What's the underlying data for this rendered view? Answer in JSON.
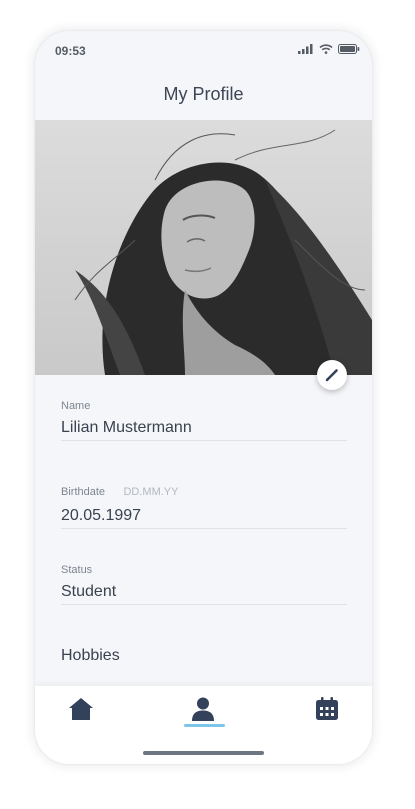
{
  "status_bar": {
    "time": "09:53",
    "icons": [
      "signal-icon",
      "wifi-icon",
      "battery-icon"
    ]
  },
  "header": {
    "title": "My Profile"
  },
  "profile": {
    "photo": "profile-photo-woman-bw",
    "edit_icon": "pencil-icon"
  },
  "fields": {
    "name": {
      "label": "Name",
      "value": "Lilian Mustermann"
    },
    "birthdate": {
      "label": "Birthdate",
      "hint": "DD.MM.YY",
      "value": "20.05.1997"
    },
    "status": {
      "label": "Status",
      "value": "Student"
    }
  },
  "hobbies": {
    "label": "Hobbies"
  },
  "tab_bar": {
    "tabs": [
      {
        "icon": "home-icon",
        "active": false
      },
      {
        "icon": "user-icon",
        "active": true
      },
      {
        "icon": "calendar-icon",
        "active": false
      }
    ],
    "accent_color": "#7dc6ea",
    "icon_color": "#33415a"
  }
}
